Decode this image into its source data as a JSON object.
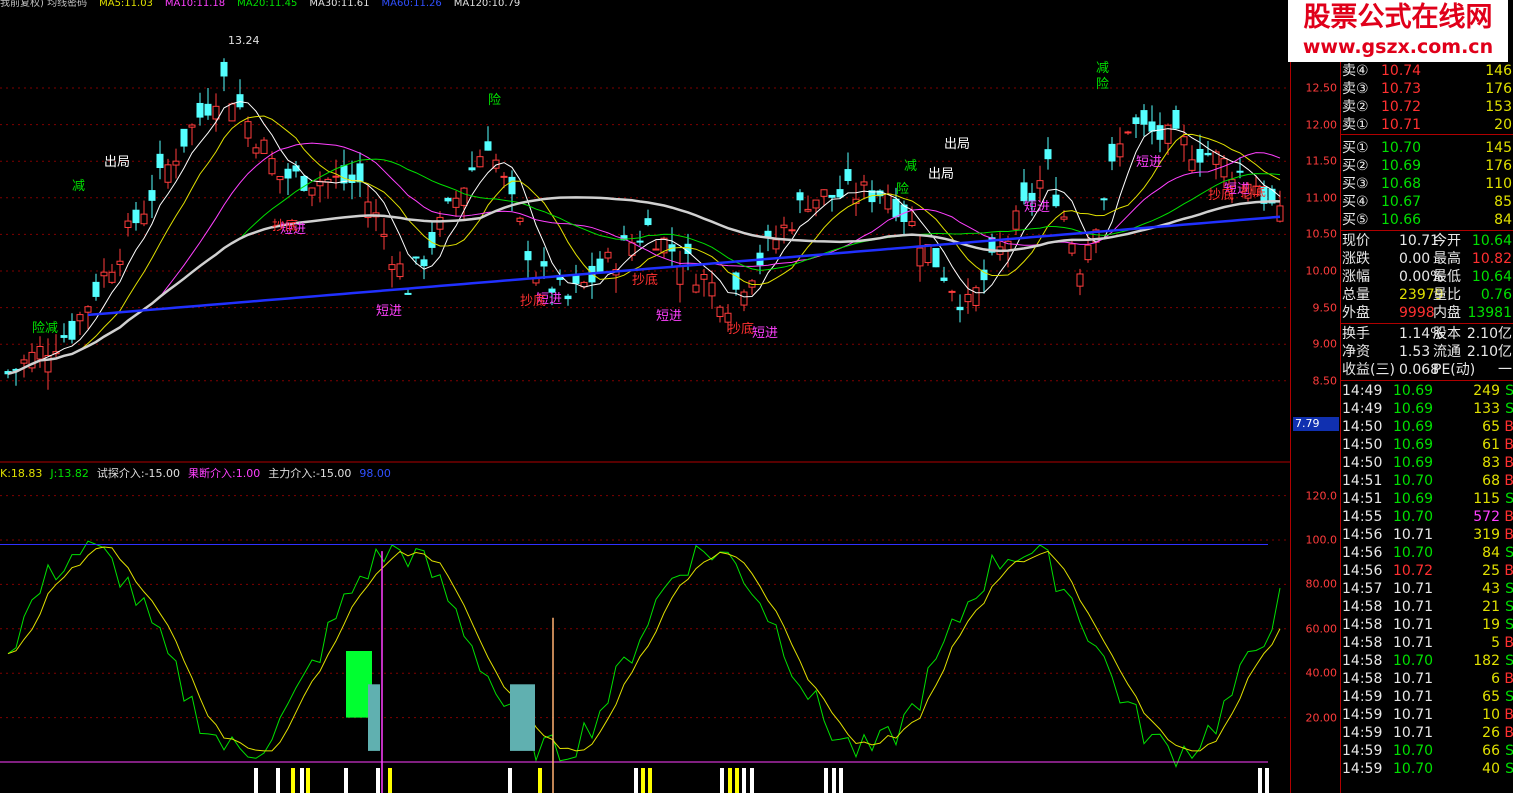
{
  "ma_legend": [
    {
      "text": "我前复权) 均线密码",
      "color": "#c0c0c0"
    },
    {
      "text": "MA5:11.03",
      "color": "#e0e000"
    },
    {
      "text": "MA10:11.18",
      "color": "#ff40ff"
    },
    {
      "text": "MA20:11.45",
      "color": "#00e000"
    },
    {
      "text": "MA30:11.61",
      "color": "#e0e0e0"
    },
    {
      "text": "MA60:11.26",
      "color": "#3050ff"
    },
    {
      "text": "MA120:10.79",
      "color": "#e0e0e0"
    }
  ],
  "osc_legend": [
    {
      "text": "K:18.83",
      "color": "#e0e000"
    },
    {
      "text": "J:13.82",
      "color": "#00e000"
    },
    {
      "text": "试探介入:-15.00",
      "color": "#e0e0e0"
    },
    {
      "text": "果断介入:1.00",
      "color": "#ff40ff"
    },
    {
      "text": "主力介入:-15.00",
      "color": "#e0e0e0"
    },
    {
      "text": "98.00",
      "color": "#3050ff"
    }
  ],
  "price_axis": [
    "12.50",
    "12.00",
    "11.50",
    "11.00",
    "10.50",
    "10.00",
    "9.50",
    "9.00",
    "8.50"
  ],
  "osc_axis": [
    "120.0",
    "100.0",
    "80.00",
    "60.00",
    "40.00",
    "20.00"
  ],
  "last_price_label": "7.79",
  "annotations": {
    "high": "13.24",
    "labels": [
      {
        "t": "减",
        "c": "#00e000"
      },
      {
        "t": "出局",
        "c": "#ffffff"
      },
      {
        "t": "险减",
        "c": "#00e000"
      },
      {
        "t": "险",
        "c": "#00e000"
      },
      {
        "t": "短进",
        "c": "#ff40ff"
      },
      {
        "t": "短进",
        "c": "#ff40ff"
      },
      {
        "t": "短进",
        "c": "#ff40ff"
      },
      {
        "t": "短进",
        "c": "#ff40ff"
      },
      {
        "t": "短进",
        "c": "#ff40ff"
      },
      {
        "t": "减",
        "c": "#00e000"
      },
      {
        "t": "险",
        "c": "#00e000"
      },
      {
        "t": "出局",
        "c": "#ffffff"
      },
      {
        "t": "减",
        "c": "#00e000"
      },
      {
        "t": "险",
        "c": "#00e000"
      },
      {
        "t": "出局",
        "c": "#ffffff"
      },
      {
        "t": "短进",
        "c": "#ff40ff"
      },
      {
        "t": "短进",
        "c": "#ff40ff"
      },
      {
        "t": "短进",
        "c": "#ff40ff"
      },
      {
        "t": "抄底",
        "c": "#ff3030"
      },
      {
        "t": "抄底",
        "c": "#ff3030"
      },
      {
        "t": "抄底",
        "c": "#ff3030"
      },
      {
        "t": "抄底",
        "c": "#ff3030"
      },
      {
        "t": "抄底",
        "c": "#ff3030"
      },
      {
        "t": "抄底",
        "c": "#ff3030"
      }
    ]
  },
  "watermark": {
    "line1": "股票公式在线网",
    "line2": "www.gszx.com.cn"
  },
  "quotes": {
    "asks": [
      {
        "label": "卖④",
        "price": "10.74",
        "vol": "146"
      },
      {
        "label": "卖③",
        "price": "10.73",
        "vol": "176"
      },
      {
        "label": "卖②",
        "price": "10.72",
        "vol": "153"
      },
      {
        "label": "卖①",
        "price": "10.71",
        "vol": "20"
      }
    ],
    "bids": [
      {
        "label": "买①",
        "price": "10.70",
        "vol": "145"
      },
      {
        "label": "买②",
        "price": "10.69",
        "vol": "176"
      },
      {
        "label": "买③",
        "price": "10.68",
        "vol": "110"
      },
      {
        "label": "买④",
        "price": "10.67",
        "vol": "85"
      },
      {
        "label": "买⑤",
        "price": "10.66",
        "vol": "84"
      }
    ],
    "stats": [
      {
        "k1": "现价",
        "v1": "10.71",
        "c1": "w",
        "k2": "今开",
        "v2": "10.64",
        "c2": "g"
      },
      {
        "k1": "涨跌",
        "v1": "0.00",
        "c1": "w",
        "k2": "最高",
        "v2": "10.82",
        "c2": "r"
      },
      {
        "k1": "涨幅",
        "v1": "0.00%",
        "c1": "w",
        "k2": "最低",
        "v2": "10.64",
        "c2": "g"
      },
      {
        "k1": "总量",
        "v1": "23979",
        "c1": "y",
        "k2": "量比",
        "v2": "0.76",
        "c2": "g"
      },
      {
        "k1": "外盘",
        "v1": "9998",
        "c1": "r",
        "k2": "内盘",
        "v2": "13981",
        "c2": "g"
      },
      {
        "k1": "换手",
        "v1": "1.14%",
        "c1": "w",
        "k2": "股本",
        "v2": "2.10亿",
        "c2": "w"
      },
      {
        "k1": "净资",
        "v1": "1.53",
        "c1": "w",
        "k2": "流通",
        "v2": "2.10亿",
        "c2": "w"
      },
      {
        "k1": "收益(三)",
        "v1": "0.068",
        "c1": "w",
        "k2": "PE(动)",
        "v2": "一",
        "c2": "w"
      }
    ],
    "ticks": [
      {
        "time": "14:49",
        "price": "10.69",
        "pc": "g",
        "vol": "249",
        "vc": "y",
        "side": "S",
        "sc": "g"
      },
      {
        "time": "14:49",
        "price": "10.69",
        "pc": "g",
        "vol": "133",
        "vc": "y",
        "side": "S",
        "sc": "g"
      },
      {
        "time": "14:50",
        "price": "10.69",
        "pc": "g",
        "vol": "65",
        "vc": "y",
        "side": "B",
        "sc": "r"
      },
      {
        "time": "14:50",
        "price": "10.69",
        "pc": "g",
        "vol": "61",
        "vc": "y",
        "side": "B",
        "sc": "r"
      },
      {
        "time": "14:50",
        "price": "10.69",
        "pc": "g",
        "vol": "83",
        "vc": "y",
        "side": "B",
        "sc": "r"
      },
      {
        "time": "14:51",
        "price": "10.70",
        "pc": "g",
        "vol": "68",
        "vc": "y",
        "side": "B",
        "sc": "r"
      },
      {
        "time": "14:51",
        "price": "10.69",
        "pc": "g",
        "vol": "115",
        "vc": "y",
        "side": "S",
        "sc": "g"
      },
      {
        "time": "14:55",
        "price": "10.70",
        "pc": "g",
        "vol": "572",
        "vc": "m",
        "side": "B",
        "sc": "r"
      },
      {
        "time": "14:56",
        "price": "10.71",
        "pc": "w",
        "vol": "319",
        "vc": "y",
        "side": "B",
        "sc": "r"
      },
      {
        "time": "14:56",
        "price": "10.70",
        "pc": "g",
        "vol": "84",
        "vc": "y",
        "side": "S",
        "sc": "g"
      },
      {
        "time": "14:56",
        "price": "10.72",
        "pc": "r",
        "vol": "25",
        "vc": "y",
        "side": "B",
        "sc": "r"
      },
      {
        "time": "14:57",
        "price": "10.71",
        "pc": "w",
        "vol": "43",
        "vc": "y",
        "side": "S",
        "sc": "g"
      },
      {
        "time": "14:58",
        "price": "10.71",
        "pc": "w",
        "vol": "21",
        "vc": "y",
        "side": "S",
        "sc": "g"
      },
      {
        "time": "14:58",
        "price": "10.71",
        "pc": "w",
        "vol": "19",
        "vc": "y",
        "side": "S",
        "sc": "g"
      },
      {
        "time": "14:58",
        "price": "10.71",
        "pc": "w",
        "vol": "5",
        "vc": "y",
        "side": "B",
        "sc": "r"
      },
      {
        "time": "14:58",
        "price": "10.70",
        "pc": "g",
        "vol": "182",
        "vc": "y",
        "side": "S",
        "sc": "g"
      },
      {
        "time": "14:58",
        "price": "10.71",
        "pc": "w",
        "vol": "6",
        "vc": "y",
        "side": "B",
        "sc": "r"
      },
      {
        "time": "14:59",
        "price": "10.71",
        "pc": "w",
        "vol": "65",
        "vc": "y",
        "side": "S",
        "sc": "g"
      },
      {
        "time": "14:59",
        "price": "10.71",
        "pc": "w",
        "vol": "10",
        "vc": "y",
        "side": "B",
        "sc": "r"
      },
      {
        "time": "14:59",
        "price": "10.71",
        "pc": "w",
        "vol": "26",
        "vc": "y",
        "side": "B",
        "sc": "r"
      },
      {
        "time": "14:59",
        "price": "10.70",
        "pc": "g",
        "vol": "66",
        "vc": "y",
        "side": "S",
        "sc": "g"
      },
      {
        "time": "14:59",
        "price": "10.70",
        "pc": "g",
        "vol": "40",
        "vc": "y",
        "side": "S",
        "sc": "g"
      }
    ]
  }
}
